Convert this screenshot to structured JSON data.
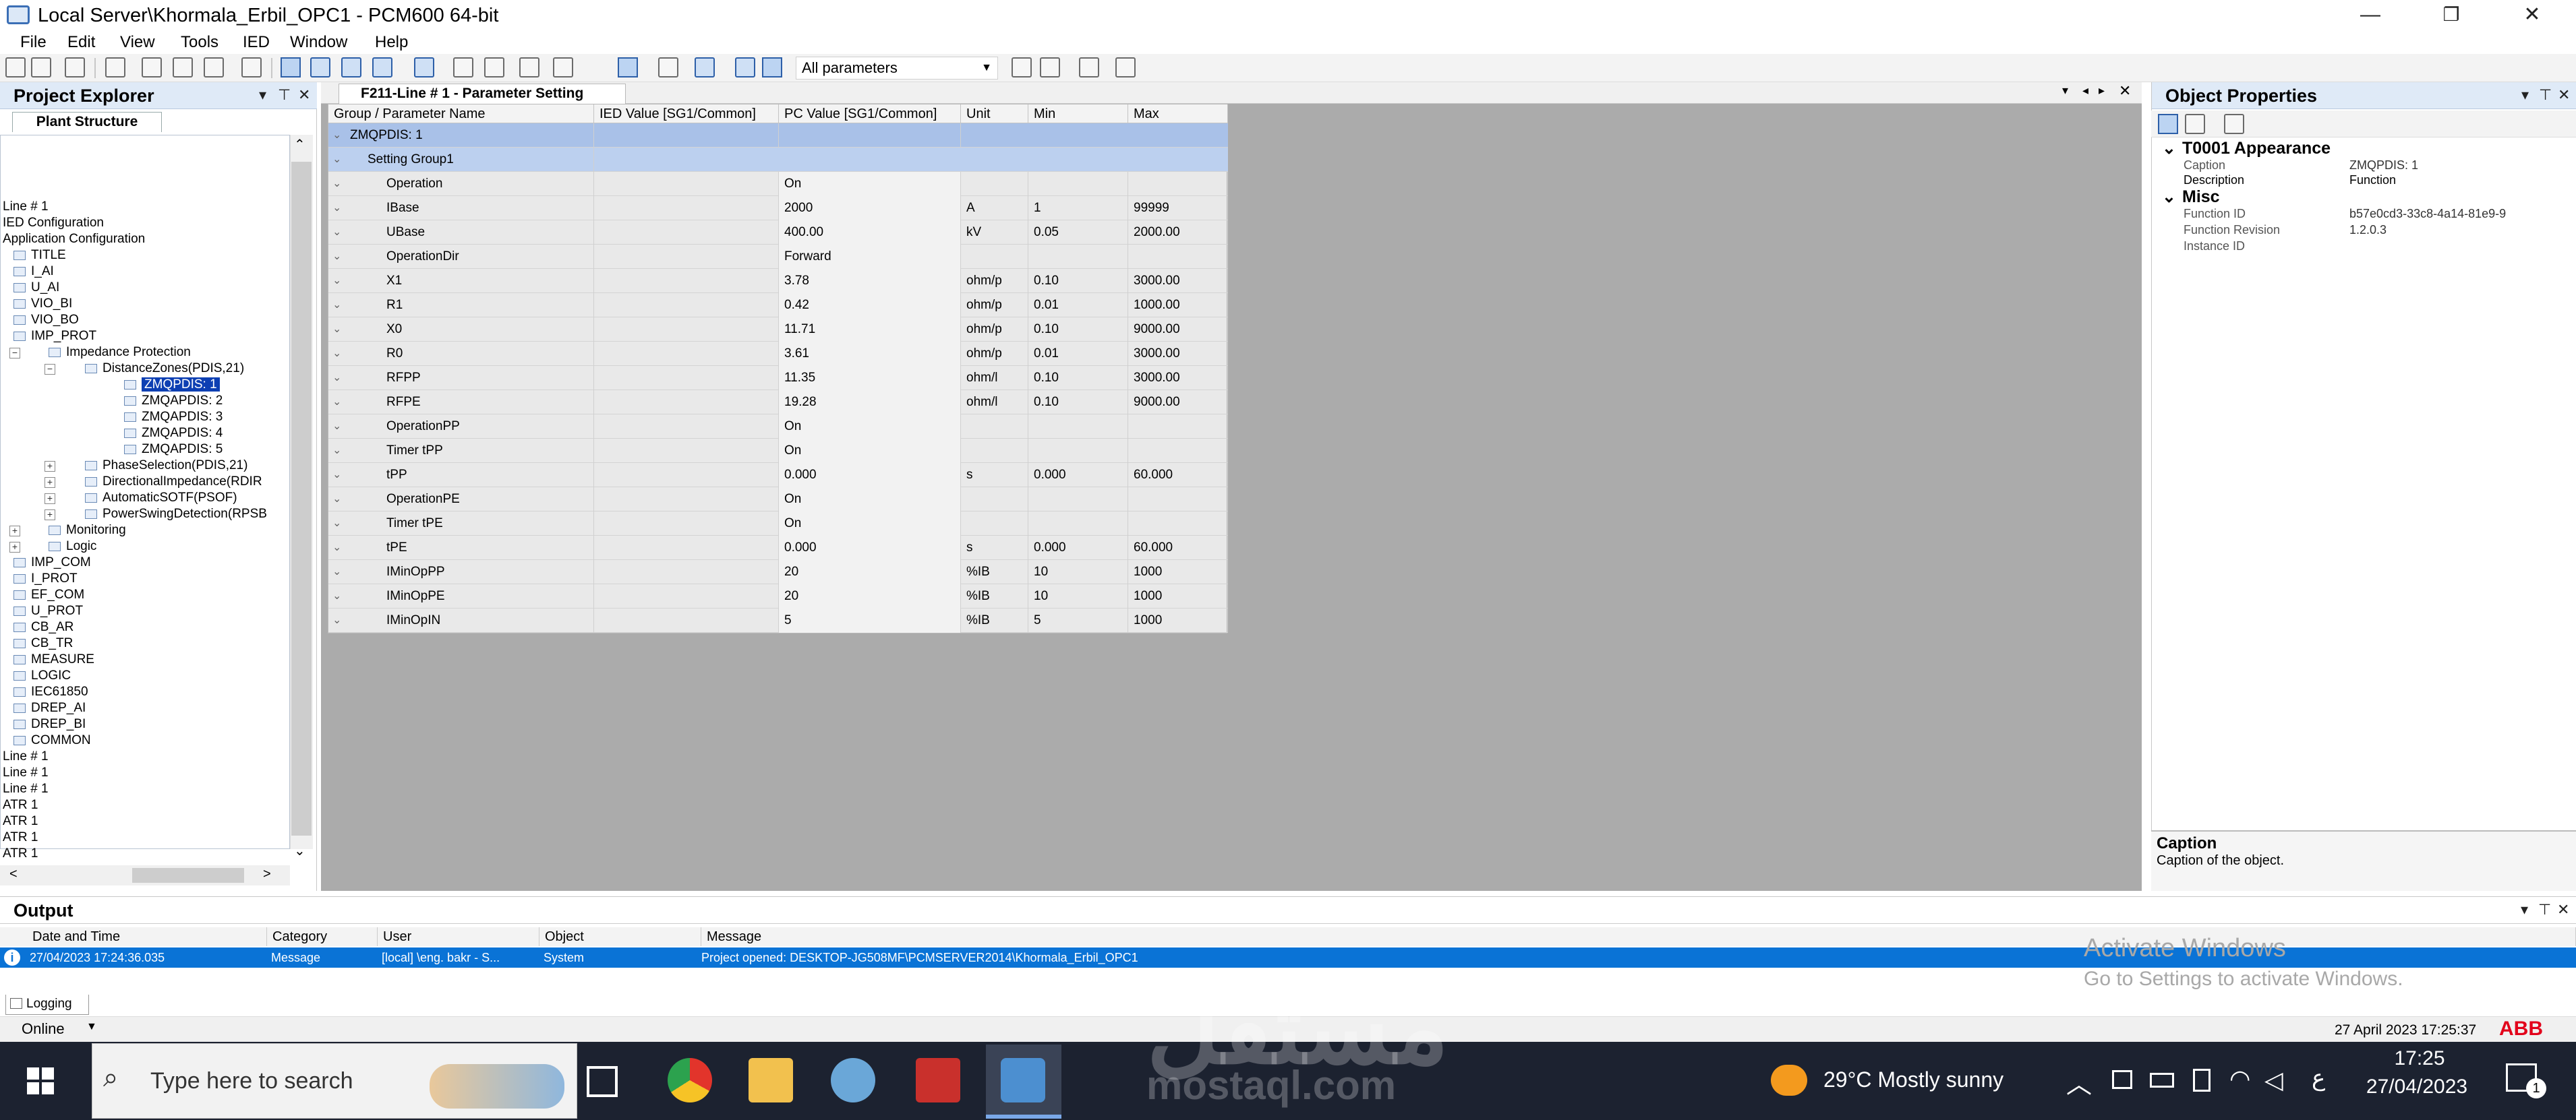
{
  "window": {
    "title": "Local Server\\Khormala_Erbil_OPC1 - PCM600 64-bit",
    "minimize": "—",
    "maximize": "❐",
    "close": "✕"
  },
  "menu": [
    "File",
    "Edit",
    "View",
    "Tools",
    "IED",
    "Window",
    "Help"
  ],
  "toolbar": {
    "filter_value": "All parameters"
  },
  "project_explorer": {
    "title": "Project Explorer",
    "tab": "Plant Structure",
    "tree": [
      "Line # 1",
      "IED Configuration",
      "Application Configuration",
      "TITLE",
      "I_AI",
      "U_AI",
      "VIO_BI",
      "VIO_BO",
      "IMP_PROT",
      "Impedance Protection",
      "DistanceZones(PDIS,21)",
      "ZMQPDIS: 1",
      "ZMQAPDIS: 2",
      "ZMQAPDIS: 3",
      "ZMQAPDIS: 4",
      "ZMQAPDIS: 5",
      "PhaseSelection(PDIS,21)",
      "DirectionalImpedance(RDIR",
      "AutomaticSOTF(PSOF)",
      "PowerSwingDetection(RPSB",
      "Monitoring",
      "Logic",
      "IMP_COM",
      "I_PROT",
      "EF_COM",
      "U_PROT",
      "CB_AR",
      "CB_TR",
      "MEASURE",
      "LOGIC",
      "IEC61850",
      "DREP_AI",
      "DREP_BI",
      "COMMON",
      "Line # 1",
      "Line # 1",
      "Line # 1",
      "ATR 1",
      "ATR 1",
      "ATR 1",
      "ATR 1"
    ]
  },
  "document": {
    "tab_title": "F211-Line # 1 - Parameter Setting",
    "columns": [
      "Group / Parameter Name",
      "IED Value [SG1/Common]",
      "PC Value [SG1/Common]",
      "Unit",
      "Min",
      "Max"
    ],
    "group": "ZMQPDIS: 1",
    "setting_group": "Setting Group1",
    "rows": [
      {
        "name": "Operation",
        "pc": "On",
        "unit": "",
        "min": "",
        "max": ""
      },
      {
        "name": "IBase",
        "pc": "2000",
        "unit": "A",
        "min": "1",
        "max": "99999"
      },
      {
        "name": "UBase",
        "pc": "400.00",
        "unit": "kV",
        "min": "0.05",
        "max": "2000.00"
      },
      {
        "name": "OperationDir",
        "pc": "Forward",
        "unit": "",
        "min": "",
        "max": ""
      },
      {
        "name": "X1",
        "pc": "3.78",
        "unit": "ohm/p",
        "min": "0.10",
        "max": "3000.00"
      },
      {
        "name": "R1",
        "pc": "0.42",
        "unit": "ohm/p",
        "min": "0.01",
        "max": "1000.00"
      },
      {
        "name": "X0",
        "pc": "11.71",
        "unit": "ohm/p",
        "min": "0.10",
        "max": "9000.00"
      },
      {
        "name": "R0",
        "pc": "3.61",
        "unit": "ohm/p",
        "min": "0.01",
        "max": "3000.00"
      },
      {
        "name": "RFPP",
        "pc": "11.35",
        "unit": "ohm/l",
        "min": "0.10",
        "max": "3000.00"
      },
      {
        "name": "RFPE",
        "pc": "19.28",
        "unit": "ohm/l",
        "min": "0.10",
        "max": "9000.00"
      },
      {
        "name": "OperationPP",
        "pc": "On",
        "unit": "",
        "min": "",
        "max": ""
      },
      {
        "name": "Timer tPP",
        "pc": "On",
        "unit": "",
        "min": "",
        "max": ""
      },
      {
        "name": "tPP",
        "pc": "0.000",
        "unit": "s",
        "min": "0.000",
        "max": "60.000"
      },
      {
        "name": "OperationPE",
        "pc": "On",
        "unit": "",
        "min": "",
        "max": ""
      },
      {
        "name": "Timer tPE",
        "pc": "On",
        "unit": "",
        "min": "",
        "max": ""
      },
      {
        "name": "tPE",
        "pc": "0.000",
        "unit": "s",
        "min": "0.000",
        "max": "60.000"
      },
      {
        "name": "IMinOpPP",
        "pc": "20",
        "unit": "%IB",
        "min": "10",
        "max": "1000"
      },
      {
        "name": "IMinOpPE",
        "pc": "20",
        "unit": "%IB",
        "min": "10",
        "max": "1000"
      },
      {
        "name": "IMinOpIN",
        "pc": "5",
        "unit": "%IB",
        "min": "5",
        "max": "1000"
      }
    ]
  },
  "object_properties": {
    "title": "Object Properties",
    "categories": [
      {
        "name": "T0001 Appearance",
        "props": [
          {
            "key": "Caption",
            "value": "ZMQPDIS: 1"
          },
          {
            "key": "Description",
            "value": "Function"
          }
        ]
      },
      {
        "name": "Misc",
        "props": [
          {
            "key": "Function ID",
            "value": "b57e0cd3-33c8-4a14-81e9-9"
          },
          {
            "key": "Function Revision",
            "value": "1.2.0.3"
          },
          {
            "key": "Instance ID",
            "value": ""
          }
        ]
      }
    ],
    "desc_title": "Caption",
    "desc_text": "Caption of the object."
  },
  "output": {
    "title": "Output",
    "columns": [
      "Date and Time",
      "Category",
      "User",
      "Object",
      "Message"
    ],
    "row": {
      "datetime": "27/04/2023 17:24:36.035",
      "category": "Message",
      "user": "[local] \\eng. bakr - S...",
      "object": "System",
      "message": "Project opened: DESKTOP-JG508MF\\PCMSERVER2014\\Khormala_Erbil_OPC1"
    },
    "tab": "Logging"
  },
  "statusbar": {
    "mode": "Online",
    "datetime": "27 April 2023 17:25:37",
    "brand": "ABB"
  },
  "activation": {
    "line1": "Activate Windows",
    "line2": "Go to Settings to activate Windows."
  },
  "watermark": {
    "logo": "مستقل",
    "url": "mostaql.com"
  },
  "taskbar": {
    "search_placeholder": "Type here to search",
    "weather": "29°C  Mostly sunny",
    "lang": "ع",
    "time": "17:25",
    "date": "27/04/2023",
    "notifications": "1"
  }
}
